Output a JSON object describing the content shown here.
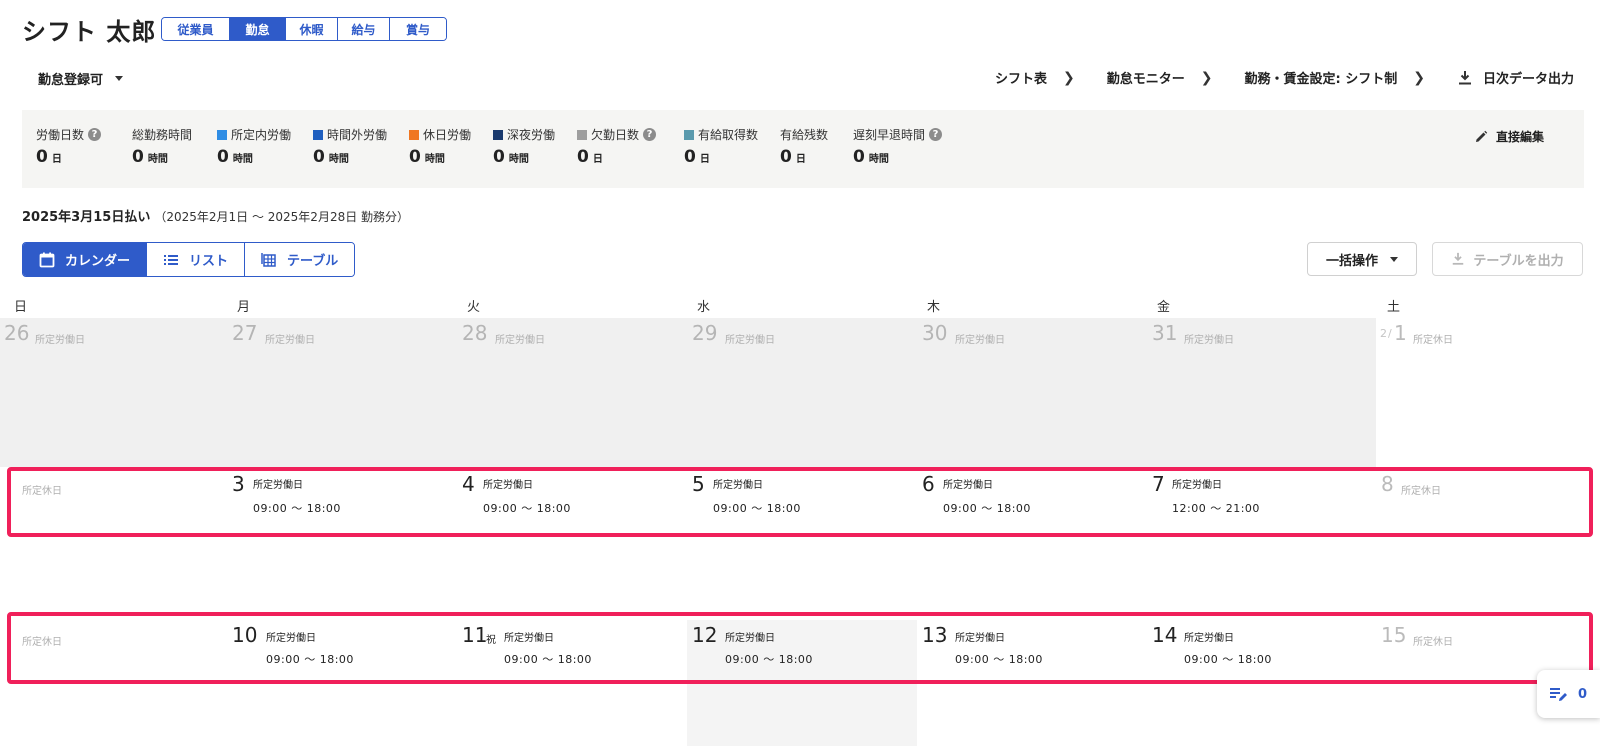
{
  "header": {
    "title": "シフト 太郎",
    "tabs": [
      "従業員",
      "勤怠",
      "休暇",
      "給与",
      "賞与"
    ],
    "status_label": "勤怠登録可",
    "links": {
      "shift_table": "シフト表",
      "attendance_monitor": "勤怠モニター",
      "work_settings": "勤務・賃金設定: シフト制",
      "daily_export": "日次データ出力"
    }
  },
  "summary": {
    "work_days": {
      "label": "労働日数",
      "value": "0",
      "unit": "日"
    },
    "total_hours": {
      "label": "総勤務時間",
      "value": "0",
      "unit": "時間"
    },
    "scheduled": {
      "label": "所定内労働",
      "value": "0",
      "unit": "時間",
      "color": "#2f8de4"
    },
    "overtime": {
      "label": "時間外労働",
      "value": "0",
      "unit": "時間",
      "color": "#1f5fbf"
    },
    "holiday_work": {
      "label": "休日労働",
      "value": "0",
      "unit": "時間",
      "color": "#f07722"
    },
    "late_night": {
      "label": "深夜労働",
      "value": "0",
      "unit": "時間",
      "color": "#1a3a6e"
    },
    "absence": {
      "label": "欠勤日数",
      "value": "0",
      "unit": "日",
      "color": "#9e9e9e"
    },
    "paid_leave_taken": {
      "label": "有給取得数",
      "value": "0",
      "unit": "日",
      "color": "#5a9aad"
    },
    "paid_leave_remaining": {
      "label": "有給残数",
      "value": "0",
      "unit": "日"
    },
    "late_early": {
      "label": "遅刻早退時間",
      "value": "0",
      "unit": "時間"
    },
    "direct_edit": "直接編集"
  },
  "period": {
    "pay_date": "2025年3月15日払い",
    "range": "（2025年2月1日 〜 2025年2月28日 勤務分）"
  },
  "views": {
    "calendar": "カレンダー",
    "list": "リスト",
    "table": "テーブル"
  },
  "actions": {
    "bulk": "一括操作",
    "export_table": "テーブルを出力"
  },
  "weekdays": [
    "日",
    "月",
    "火",
    "水",
    "木",
    "金",
    "土"
  ],
  "labels": {
    "workday": "所定労働日",
    "holiday": "所定休日",
    "national_holiday": "祝"
  },
  "week1": {
    "d0": "26",
    "d1": "27",
    "d2": "28",
    "d3": "29",
    "d4": "30",
    "d5": "31",
    "d6_month": "2",
    "d6_sep": "/",
    "d6": "1"
  },
  "week2": {
    "d1": "3",
    "d2": "4",
    "d3": "5",
    "d4": "6",
    "d5": "7",
    "d6": "8",
    "t1": "09:00 〜 18:00",
    "t2": "09:00 〜 18:00",
    "t3": "09:00 〜 18:00",
    "t4": "09:00 〜 18:00",
    "t5": "12:00 〜 21:00"
  },
  "week3": {
    "d1": "10",
    "d2": "11",
    "d3": "12",
    "d4": "13",
    "d5": "14",
    "d6": "15",
    "t1": "09:00 〜 18:00",
    "t2": "09:00 〜 18:00",
    "t3": "09:00 〜 18:00",
    "t4": "09:00 〜 18:00",
    "t5": "09:00 〜 18:00"
  },
  "floating": {
    "count": "0"
  }
}
